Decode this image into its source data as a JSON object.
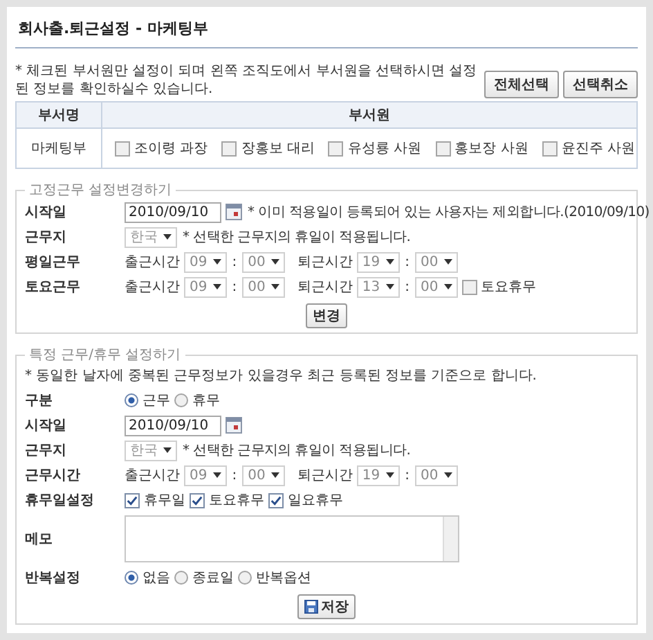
{
  "title": "회사출.퇴근설정 - 마케팅부",
  "notice": "* 체크된 부서원만 설정이 되며 왼쪽 조직도에서 부서원을 선택하시면 설정된 정보를 확인하실수 있습니다.",
  "buttons": [
    {
      "label": "전체선택"
    },
    {
      "label": "선택취소"
    }
  ],
  "members_table": {
    "columns": [
      "부서명",
      "부서원"
    ],
    "rows": [
      {
        "department": "마케팅부",
        "members": [
          {
            "name": "조이령 과장",
            "checked": false
          },
          {
            "name": "장홍보 대리",
            "checked": false
          },
          {
            "name": "유성룡 사원",
            "checked": false
          },
          {
            "name": "홍보장 사원",
            "checked": false
          },
          {
            "name": "윤진주 사원",
            "checked": false
          }
        ]
      }
    ]
  },
  "fixed_section": {
    "legend": "고정근무 설정변경하기",
    "rows": [
      {
        "kind": "date",
        "label": "시작일",
        "value": "2010/09/10",
        "note": "* 이미 적용일이 등록되어 있는 사용자는 제외합니다.(2010/09/10)"
      },
      {
        "kind": "place",
        "label": "근무지",
        "value": "한국",
        "note": "* 선택한 근무지의 휴일이 적용됩니다."
      },
      {
        "kind": "time",
        "label": "평일근무",
        "start_label": "출근시간",
        "start_hour": "09",
        "separator": ":",
        "start_min": "00",
        "end_label": "퇴근시간",
        "end_hour": "19",
        "end_separator": ":",
        "end_min": "00"
      },
      {
        "kind": "time",
        "label": "토요근무",
        "start_label": "출근시간",
        "start_hour": "09",
        "separator": ":",
        "start_min": "00",
        "end_label": "퇴근시간",
        "end_hour": "13",
        "end_separator": ":",
        "end_min": "00",
        "check": {
          "label": "토요휴무",
          "checked": false
        }
      }
    ],
    "button": "변경"
  },
  "special_section": {
    "legend": "특정 근무/휴무 설정하기",
    "note": "* 동일한 날자에 중복된 근무정보가 있을경우 최근 등록된 정보를 기준으로 합니다.",
    "rows": [
      {
        "kind": "radio",
        "label": "구분",
        "options": [
          {
            "label": "근무",
            "selected": true
          },
          {
            "label": "휴무",
            "selected": false
          }
        ]
      },
      {
        "kind": "date",
        "label": "시작일",
        "value": "2010/09/10"
      },
      {
        "kind": "place",
        "label": "근무지",
        "value": "한국",
        "note": "* 선택한 근무지의 휴일이 적용됩니다."
      },
      {
        "kind": "time",
        "label": "근무시간",
        "start_label": "출근시간",
        "start_hour": "09",
        "separator": ":",
        "start_min": "00",
        "end_label": "퇴근시간",
        "end_hour": "19",
        "end_separator": ":",
        "end_min": "00"
      },
      {
        "kind": "checks",
        "label": "휴무일설정",
        "options": [
          {
            "label": "휴무일",
            "checked": true
          },
          {
            "label": "토요휴무",
            "checked": true
          },
          {
            "label": "일요휴무",
            "checked": true
          }
        ]
      },
      {
        "kind": "memo",
        "label": "메모"
      },
      {
        "kind": "radio",
        "label": "반복설정",
        "options": [
          {
            "label": "없음",
            "selected": true
          },
          {
            "label": "종료일",
            "selected": false
          },
          {
            "label": "반복옵션",
            "selected": false
          }
        ]
      }
    ],
    "button": "저장"
  }
}
